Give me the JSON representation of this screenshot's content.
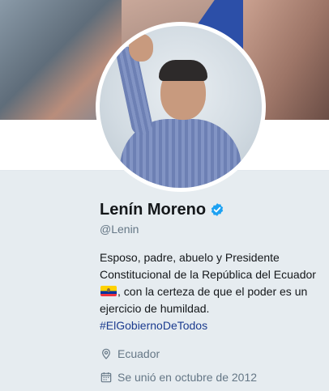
{
  "profile": {
    "name": "Lenín Moreno",
    "handle": "@Lenin",
    "bio_part1": "Esposo, padre, abuelo y Presidente Constitucional de la República del Ecuador",
    "bio_part2": ", con la certeza de que el poder es un ejercicio de humildad.",
    "hashtag": "#ElGobiernoDeTodos",
    "location": "Ecuador",
    "joined": "Se unió en octubre de 2012"
  },
  "colors": {
    "verified": "#1da1f2",
    "link": "#1b3b8f",
    "secondary_text": "#657786",
    "background": "#e6ecf0"
  },
  "icons": {
    "verified": "verified-badge-icon",
    "flag": "ecuador-flag-icon",
    "location": "location-pin-icon",
    "calendar": "calendar-icon"
  }
}
